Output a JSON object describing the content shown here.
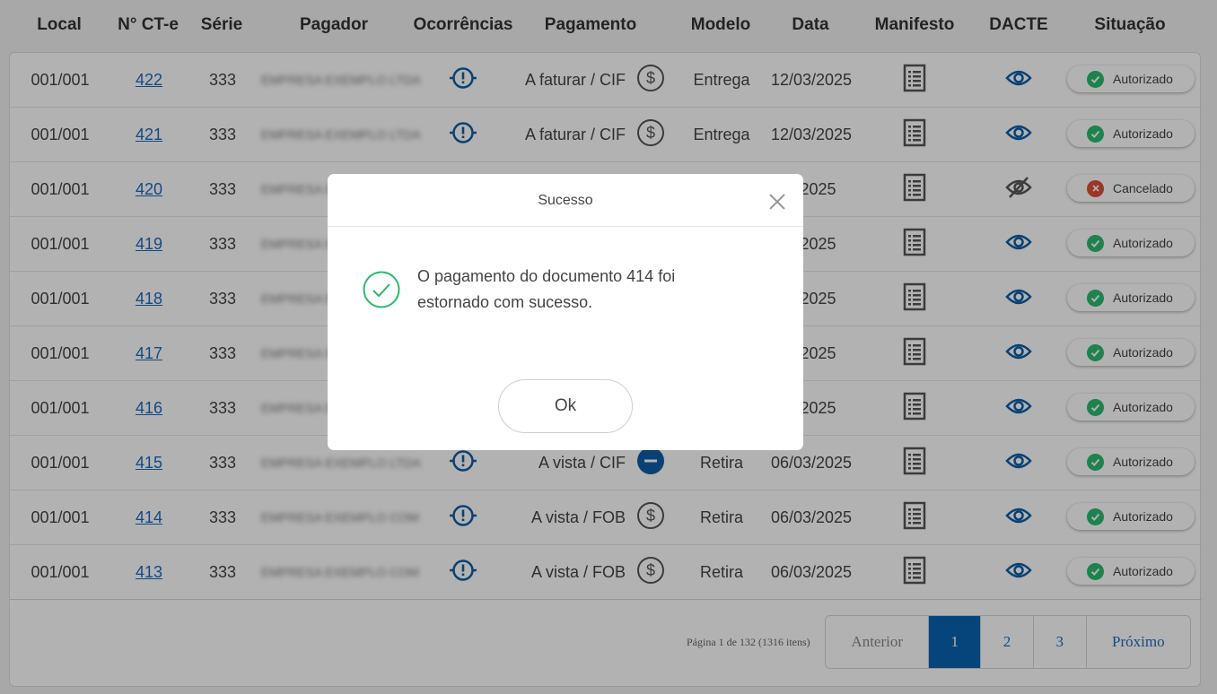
{
  "columns": [
    "Local",
    "N° CT-e",
    "Série",
    "Pagador",
    "Ocorrências",
    "Pagamento",
    "Modelo",
    "Data",
    "Manifesto",
    "DACTE",
    "Situação"
  ],
  "rows": [
    {
      "local": "001/001",
      "cte": "422",
      "serie": "333",
      "pagador": "EMPRESA EXEMPLO LTDA",
      "pagamento": "A faturar / CIF",
      "pay_icon": "dollar-icon",
      "modelo": "Entrega",
      "data": "12/03/2025",
      "dacte_icon": "eye-icon",
      "situacao": "Autorizado",
      "status": "ok"
    },
    {
      "local": "001/001",
      "cte": "421",
      "serie": "333",
      "pagador": "EMPRESA EXEMPLO LTDA",
      "pagamento": "A faturar / CIF",
      "pay_icon": "dollar-icon",
      "modelo": "Entrega",
      "data": "12/03/2025",
      "dacte_icon": "eye-icon",
      "situacao": "Autorizado",
      "status": "ok"
    },
    {
      "local": "001/001",
      "cte": "420",
      "serie": "333",
      "pagador": "EMPRESA EXEMPLO LTDA",
      "pagamento": "",
      "pay_icon": "",
      "modelo": "",
      "data": "3/2025",
      "dacte_icon": "eye-off-icon",
      "situacao": "Cancelado",
      "status": "cancel"
    },
    {
      "local": "001/001",
      "cte": "419",
      "serie": "333",
      "pagador": "EMPRESA EXEMPLO LTDA",
      "pagamento": "",
      "pay_icon": "",
      "modelo": "",
      "data": "3/2025",
      "dacte_icon": "eye-icon",
      "situacao": "Autorizado",
      "status": "ok"
    },
    {
      "local": "001/001",
      "cte": "418",
      "serie": "333",
      "pagador": "EMPRESA EXEMPLO LTDA",
      "pagamento": "",
      "pay_icon": "",
      "modelo": "",
      "data": "3/2025",
      "dacte_icon": "eye-icon",
      "situacao": "Autorizado",
      "status": "ok"
    },
    {
      "local": "001/001",
      "cte": "417",
      "serie": "333",
      "pagador": "EMPRESA EXEMPLO LTDA",
      "pagamento": "",
      "pay_icon": "",
      "modelo": "",
      "data": "3/2025",
      "dacte_icon": "eye-icon",
      "situacao": "Autorizado",
      "status": "ok"
    },
    {
      "local": "001/001",
      "cte": "416",
      "serie": "333",
      "pagador": "EMPRESA EXEMPLO LTDA",
      "pagamento": "",
      "pay_icon": "",
      "modelo": "",
      "data": "3/2025",
      "dacte_icon": "eye-icon",
      "situacao": "Autorizado",
      "status": "ok"
    },
    {
      "local": "001/001",
      "cte": "415",
      "serie": "333",
      "pagador": "EMPRESA EXEMPLO LTDA",
      "pagamento": "A vista / CIF",
      "pay_icon": "minus-circle-icon",
      "modelo": "Retira",
      "data": "06/03/2025",
      "dacte_icon": "eye-icon",
      "situacao": "Autorizado",
      "status": "ok"
    },
    {
      "local": "001/001",
      "cte": "414",
      "serie": "333",
      "pagador": "EMPRESA EXEMPLO COM",
      "pagamento": "A vista / FOB",
      "pay_icon": "dollar-icon",
      "modelo": "Retira",
      "data": "06/03/2025",
      "dacte_icon": "eye-icon",
      "situacao": "Autorizado",
      "status": "ok"
    },
    {
      "local": "001/001",
      "cte": "413",
      "serie": "333",
      "pagador": "EMPRESA EXEMPLO COM",
      "pagamento": "A vista / FOB",
      "pay_icon": "dollar-icon",
      "modelo": "Retira",
      "data": "06/03/2025",
      "dacte_icon": "eye-icon",
      "situacao": "Autorizado",
      "status": "ok"
    }
  ],
  "pager": {
    "info": "Página 1 de 132 (1316 itens)",
    "prev": "Anterior",
    "pages": [
      "1",
      "2",
      "3"
    ],
    "next": "Próximo"
  },
  "modal": {
    "title": "Sucesso",
    "message": "O pagamento do documento 414 foi estornado com sucesso.",
    "ok_label": "Ok"
  },
  "colors": {
    "accent": "#0a63b0",
    "link": "#1a6ac0",
    "success": "#2bba6e",
    "danger": "#e04e3a",
    "icon_blue": "#0d5ea8",
    "icon_gray": "#555555"
  }
}
